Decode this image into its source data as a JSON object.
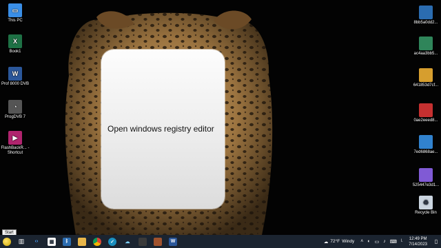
{
  "desktop_left": [
    {
      "label": "This PC",
      "icon": "monitor-icon",
      "color": "#3a8ee6"
    },
    {
      "label": "Book1",
      "icon": "excel-icon",
      "color": "#1e7145"
    },
    {
      "label": "Prof 8000 DVB",
      "icon": "word-icon",
      "color": "#2b579a"
    },
    {
      "label": "ProgDVB 7",
      "icon": "satellite-dish-icon",
      "color": "#555555"
    },
    {
      "label": "FlashBackR... - Shortcut",
      "icon": "recorder-icon",
      "color": "#b0246e"
    }
  ],
  "desktop_right": [
    {
      "label": "8bb5a0dd2...",
      "icon": "image-file-icon",
      "color": "#2b6cb0"
    },
    {
      "label": "ac4aa3bb5...",
      "icon": "image-file-icon",
      "color": "#2f855a"
    },
    {
      "label": "641853d7cf...",
      "icon": "image-file-icon",
      "color": "#d69e2e"
    },
    {
      "label": "0ae2eeed8...",
      "icon": "image-file-icon",
      "color": "#c53030"
    },
    {
      "label": "7ed6868ae...",
      "icon": "image-file-icon",
      "color": "#3182ce"
    },
    {
      "label": "525447e3d1...",
      "icon": "image-file-icon",
      "color": "#805ad5"
    },
    {
      "label": "Recycle Bin",
      "icon": "recycle-bin-icon",
      "color": "#cbd5e0"
    }
  ],
  "card": {
    "text": "Open windows registry editor"
  },
  "tooltip": {
    "text": "Start"
  },
  "taskbar": {
    "weather": {
      "temp": "72°F",
      "condition": "Windy"
    },
    "clock": {
      "time": "12:49 PM",
      "date": "7/14/2023"
    }
  }
}
